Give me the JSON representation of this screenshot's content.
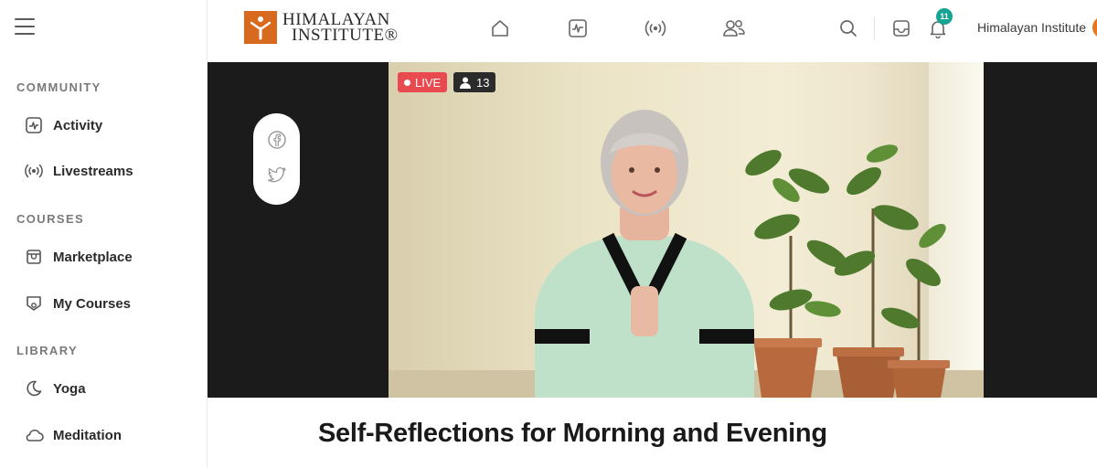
{
  "brand": {
    "name_line1": "HIMALAYAN",
    "name_line2": "INSTITUTE®",
    "accent_color": "#d86a1f"
  },
  "sidebar": {
    "sections": [
      {
        "title": "COMMUNITY",
        "items": [
          {
            "label": "Activity",
            "icon": "activity-icon"
          },
          {
            "label": "Livestreams",
            "icon": "broadcast-icon"
          }
        ]
      },
      {
        "title": "COURSES",
        "items": [
          {
            "label": "Marketplace",
            "icon": "store-icon"
          },
          {
            "label": "My Courses",
            "icon": "course-badge-icon"
          }
        ]
      },
      {
        "title": "LIBRARY",
        "items": [
          {
            "label": "Yoga",
            "icon": "moon-icon"
          },
          {
            "label": "Meditation",
            "icon": "cloud-icon"
          }
        ]
      }
    ]
  },
  "header": {
    "nav_icons": [
      "home-icon",
      "activity-icon",
      "broadcast-icon",
      "members-icon"
    ],
    "notification_count": "11",
    "notification_badge_color": "#16a393",
    "user_name": "Himalayan Institute"
  },
  "video": {
    "live_label": "LIVE",
    "live_color": "#e84a4f",
    "viewer_count": "13",
    "share_buttons": [
      "facebook-icon",
      "twitter-icon"
    ],
    "title": "Self-Reflections for Morning and Evening"
  }
}
